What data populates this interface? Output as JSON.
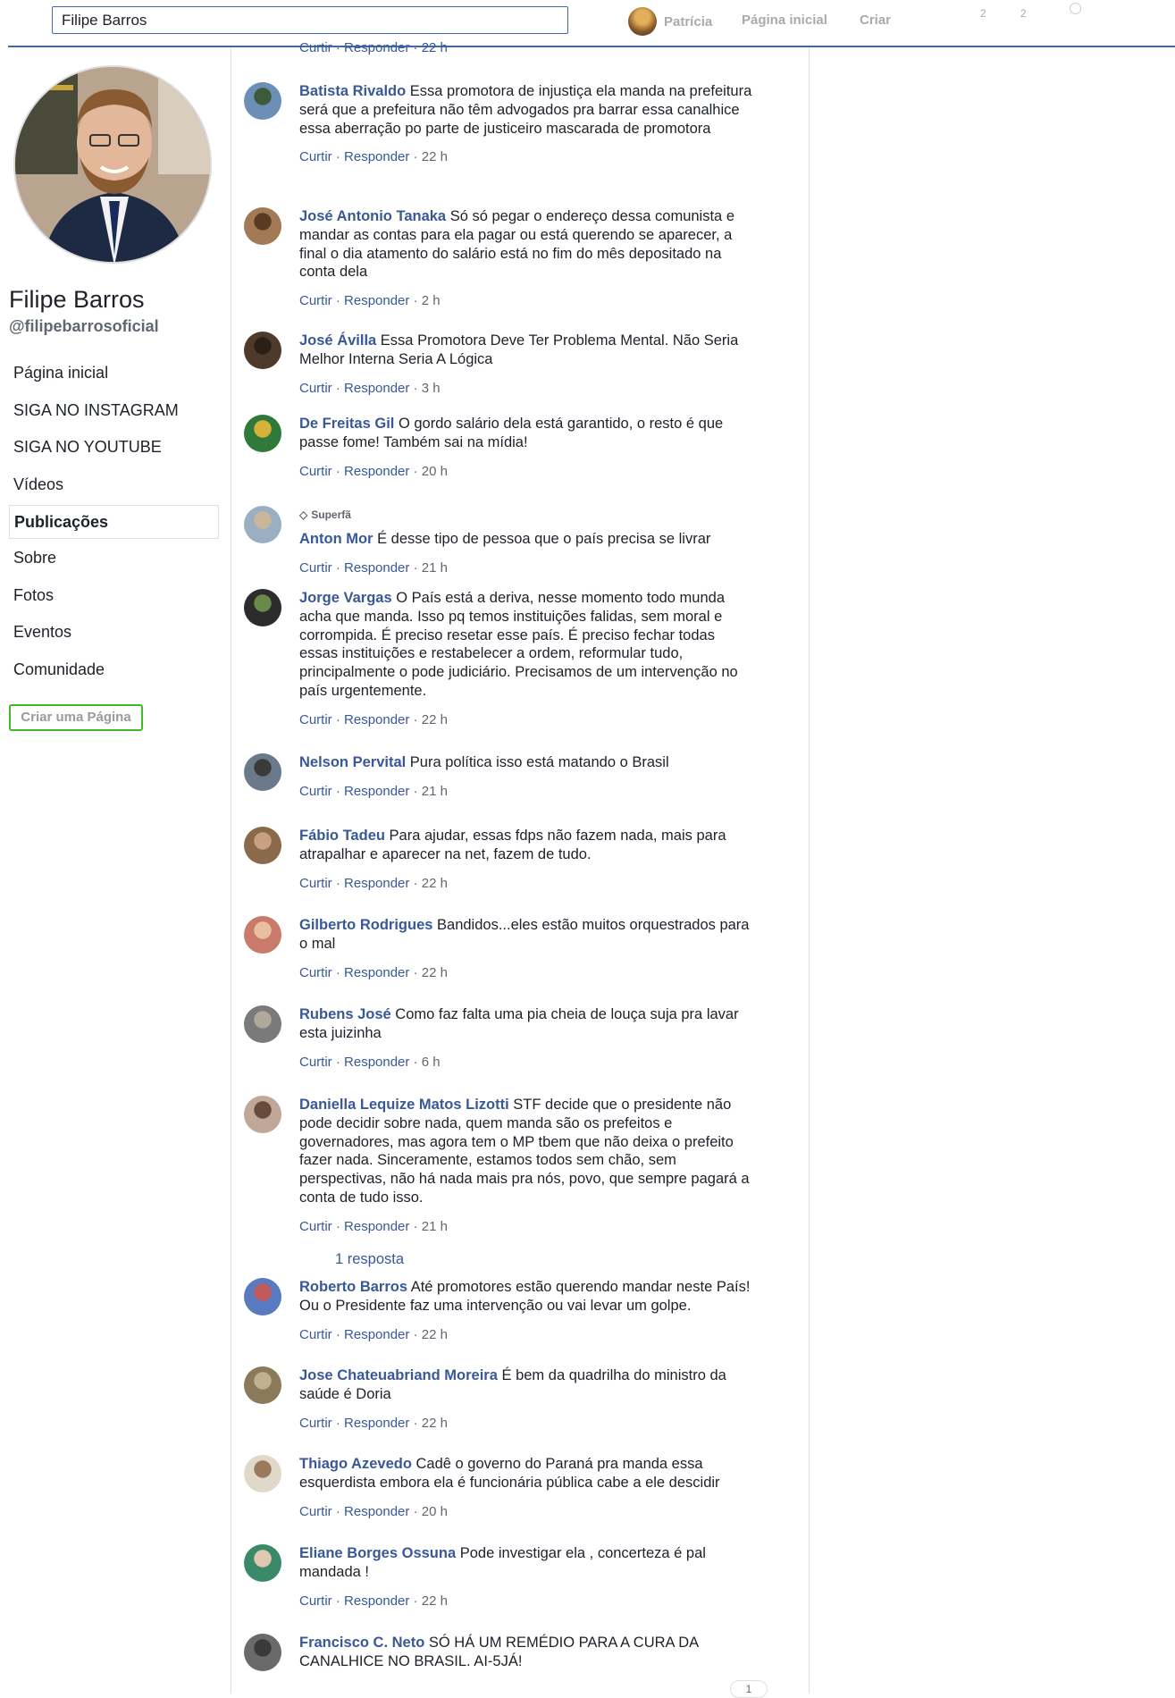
{
  "header": {
    "search_value": "Filipe Barros",
    "user_name": "Patrícia",
    "home_label": "Página inicial",
    "create_label": "Criar",
    "count_1": "2",
    "count_2": "2"
  },
  "profile": {
    "name": "Filipe Barros",
    "handle": "@filipebarrosoficial"
  },
  "sidebar": {
    "items": [
      {
        "label": "Página inicial"
      },
      {
        "label": "SIGA NO INSTAGRAM"
      },
      {
        "label": "SIGA NO YOUTUBE"
      },
      {
        "label": "Vídeos"
      },
      {
        "label": "Publicações"
      },
      {
        "label": "Sobre"
      },
      {
        "label": "Fotos"
      },
      {
        "label": "Eventos"
      },
      {
        "label": "Comunidade"
      }
    ],
    "create_page": "Criar uma Página"
  },
  "actions": {
    "like": "Curtir",
    "reply": "Responder",
    "sep": " · "
  },
  "top_partial": "Curtir · Responder · 22 h",
  "comments": [
    {
      "author": "Batista Rivaldo",
      "text": "Essa promotora de injustiça ela manda na prefeitura será que a prefeitura não têm advogados pra barrar essa canalhice essa aberração po parte de justiceiro mascarada de promotora",
      "time": "22 h"
    },
    {
      "author": "José Antonio Tanaka",
      "text": "Só só pegar o endereço dessa comunista e mandar as contas para ela pagar ou está querendo se aparecer, a final o dia atamento do salário está no fim do mês depositado na conta dela",
      "time": "2 h"
    },
    {
      "author": "José Ávilla",
      "text": "Essa Promotora Deve Ter Problema Mental. Não Seria Melhor Interna Seria A Lógica",
      "time": "3 h"
    },
    {
      "author": "De Freitas Gil",
      "text": "O gordo salário dela está garantido, o resto é que passe fome! Também sai na mídia!",
      "time": "20 h"
    },
    {
      "author": "Anton Mor",
      "text": "É desse tipo de pessoa que o país precisa se livrar",
      "time": "21 h",
      "badge": "Superfã"
    },
    {
      "author": "Jorge Vargas",
      "text": "O País está a deriva, nesse momento todo munda acha que manda. Isso pq temos instituições falidas, sem moral e corrompida. É preciso resetar esse país. É preciso fechar todas essas instituições e restabelecer a ordem, reformular tudo, principalmente o pode judiciário. Precisamos de um intervenção no país urgentemente.",
      "time": "22 h"
    },
    {
      "author": "Nelson Pervital",
      "text": "Pura política isso está matando o Brasil",
      "time": "21 h"
    },
    {
      "author": "Fábio Tadeu",
      "text": "Para ajudar, essas fdps não fazem nada, mais para atrapalhar e aparecer na net, fazem de tudo.",
      "time": "22 h"
    },
    {
      "author": "Gilberto Rodrigues",
      "text": "Bandidos...eles estão muitos orquestrados para o mal",
      "time": "22 h"
    },
    {
      "author": "Rubens José",
      "text": "Como faz falta uma pia cheia de louça suja pra lavar esta juizinha",
      "time": "6 h"
    },
    {
      "author": "Daniella Lequize Matos Lizotti",
      "text": "STF decide que o presidente não pode decidir sobre nada, quem manda são os prefeitos e governadores, mas agora tem o MP tbem que não deixa o prefeito fazer nada. Sinceramente, estamos todos sem chão, sem perspectivas, não há nada mais pra nós, povo, que sempre pagará a conta de tudo isso.",
      "time": "21 h"
    },
    {
      "author": "Roberto Barros",
      "text": "Até promotores estão querendo mandar neste País! Ou o Presidente faz uma intervenção ou vai levar um golpe.",
      "time": "22 h"
    },
    {
      "author": "Jose Chateuabriand Moreira",
      "text": "É bem da quadrilha do ministro da saúde é Doria",
      "time": "22 h"
    },
    {
      "author": "Thiago Azevedo",
      "text": "Cadê o governo do Paraná pra manda essa esquerdista embora ela é funcionária pública cabe a ele descidir",
      "time": "20 h"
    },
    {
      "author": "Eliane Borges Ossuna",
      "text": "Pode investigar ela , concerteza é pal mandada !",
      "time": "22 h"
    },
    {
      "author": "Francisco C. Neto",
      "text": "SÓ HÁ UM REMÉDIO PARA A CURA DA CANALHICE NO BRASIL. AI-5JÁ!",
      "time": ""
    }
  ],
  "reply_count": "1 resposta",
  "bottom_count": "1",
  "colors": {
    "link": "#385898",
    "accent": "#4267b2",
    "green": "#42b72a"
  }
}
